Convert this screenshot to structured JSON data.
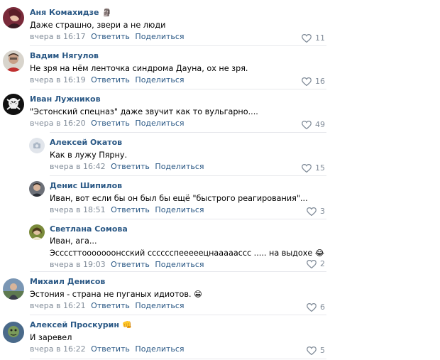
{
  "colors": {
    "link": "#2a5885",
    "meta": "#818c99",
    "separator": "#e7e8ec"
  },
  "comments": [
    {
      "author": "Аня Комахидзе",
      "author_emoji": "🗿",
      "text": [
        "Даже страшно, звери а не люди"
      ],
      "date": "вчера в 16:17",
      "reply_label": "Ответить",
      "share_label": "Поделиться",
      "likes": "11",
      "avatar": "photo-avatar"
    },
    {
      "author": "Вадим Нягулов",
      "author_emoji": "",
      "text": [
        "Не зря на нём ленточка синдрома Дауна, ох не зря."
      ],
      "date": "вчера в 16:19",
      "reply_label": "Ответить",
      "share_label": "Поделиться",
      "likes": "16",
      "avatar": "photo-avatar"
    },
    {
      "author": "Иван Лужников",
      "author_emoji": "",
      "text": [
        "\"Эстонский спецназ\" даже звучит как то вульгарно...."
      ],
      "date": "вчера в 16:20",
      "reply_label": "Ответить",
      "share_label": "Поделиться",
      "likes": "49",
      "avatar": "skull-avatar"
    },
    {
      "author": "Алексей Окатов",
      "author_emoji": "",
      "text": [
        "Как в лужу Пярну."
      ],
      "date": "вчера в 16:42",
      "reply_label": "Ответить",
      "share_label": "Поделиться",
      "likes": "15",
      "avatar": "camera-placeholder-avatar"
    },
    {
      "author": "Денис Шипилов",
      "author_emoji": "",
      "text": [
        "Иван, вот если бы он был бы ещё \"быстрого реагирования\"..."
      ],
      "date": "вчера в 18:51",
      "reply_label": "Ответить",
      "share_label": "Поделиться",
      "likes": "3",
      "avatar": "photo-avatar"
    },
    {
      "author": "Светлана Сомова",
      "author_emoji": "",
      "text": [
        "Иван, ага...",
        "Эссссттооооооонсский сссссспееееецнааааассс ..... на выдохе 😂"
      ],
      "date": "вчера в 19:03",
      "reply_label": "Ответить",
      "share_label": "Поделиться",
      "likes": "2",
      "avatar": "photo-avatar"
    },
    {
      "author": "Михаил Денисов",
      "author_emoji": "",
      "text": [
        "Эстония - страна не пуганых идиотов. 😁"
      ],
      "date": "вчера в 16:21",
      "reply_label": "Ответить",
      "share_label": "Поделиться",
      "likes": "6",
      "avatar": "photo-avatar"
    },
    {
      "author": "Алексей Проскурин",
      "author_emoji": "👊",
      "text": [
        "И заревел"
      ],
      "date": "вчера в 16:22",
      "reply_label": "Ответить",
      "share_label": "Поделиться",
      "likes": "5",
      "avatar": "photo-avatar"
    }
  ]
}
